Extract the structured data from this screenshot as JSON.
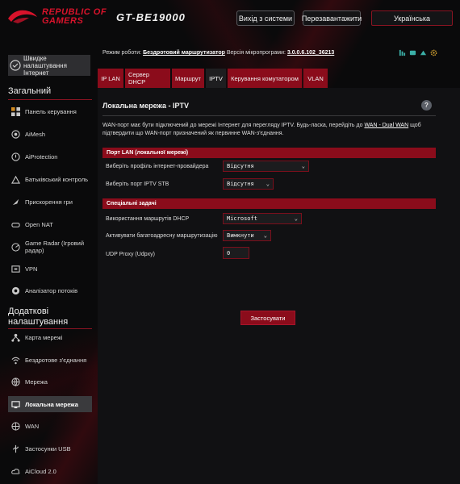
{
  "header": {
    "brand_line1": "REPUBLIC OF",
    "brand_line2": "GAMERS",
    "model": "GT-BE19000",
    "logout_label": "Вихід з системи",
    "reboot_label": "Перезавантажити",
    "language": "Українська"
  },
  "sidebar": {
    "quick_setup": "Швидке налаштування Інтернет",
    "general_title": "Загальний",
    "general_items": [
      {
        "label": "Панель керування",
        "icon": "dashboard-icon"
      },
      {
        "label": "AiMesh",
        "icon": "mesh-icon"
      },
      {
        "label": "AiProtection",
        "icon": "shield-icon"
      },
      {
        "label": "Батьківський контроль",
        "icon": "parental-icon"
      },
      {
        "label": "Прискорення гри",
        "icon": "rocket-icon"
      },
      {
        "label": "Open NAT",
        "icon": "gamepad-icon"
      },
      {
        "label": "Game Radar (Ігровий радар)",
        "icon": "radar-icon"
      },
      {
        "label": "VPN",
        "icon": "vpn-icon"
      },
      {
        "label": "Аналізатор потоків",
        "icon": "analyzer-icon"
      }
    ],
    "advanced_title": "Додаткові налаштування",
    "advanced_items": [
      {
        "label": "Карта мережі",
        "icon": "network-map-icon"
      },
      {
        "label": "Бездротове з'єднання",
        "icon": "wireless-icon"
      },
      {
        "label": "Мережа",
        "icon": "globe-icon"
      },
      {
        "label": "Локальна мережа",
        "icon": "lan-icon"
      },
      {
        "label": "WAN",
        "icon": "wan-icon"
      },
      {
        "label": "Застосунки USB",
        "icon": "usb-icon"
      },
      {
        "label": "AiCloud 2.0",
        "icon": "cloud-icon"
      }
    ]
  },
  "status": {
    "mode_prefix": "Режим роботи:",
    "mode_value": "Бездротовий маршрутизатор",
    "fw_prefix": "Версія мікропрограми:",
    "fw_value": "3.0.0.6.102_36213"
  },
  "tabs": [
    "IP LAN",
    "Сервер DHCP",
    "Маршрут",
    "IPTV",
    "Керування комутатором",
    "VLAN"
  ],
  "page": {
    "title": "Локальна мережа - IPTV",
    "desc_part1": "WAN-порт має бути підключений до мережі Інтернет для перегляду IPTV. Будь-ласка, перейдіть до ",
    "desc_link": "WAN - Dual WAN",
    "desc_part2": " щоб підтвердити що WAN-порт призначений як первинне WAN-з'єднання.",
    "section_lan": "Порт LAN (локальної мережі)",
    "isp_profile_label": "Виберіть профіль інтернет-провайдера",
    "isp_profile_value": "Відсутня",
    "stb_port_label": "Виберіть порт IPTV STB",
    "stb_port_value": "Відсутня",
    "section_special": "Спеціальні задачі",
    "dhcp_routes_label": "Використання маршрутів DHCP",
    "dhcp_routes_value": "Microsoft",
    "multicast_label": "Активувати багатоадресну маршрутизацію",
    "multicast_value": "Вимкнути",
    "udp_proxy_label": "UDP Proxy (Udpxy)",
    "udp_proxy_value": "0",
    "apply_label": "Застосувати"
  },
  "colors": {
    "accent": "#8b0c1b",
    "brand_red": "#d8132b",
    "background": "#0a0a0b"
  }
}
